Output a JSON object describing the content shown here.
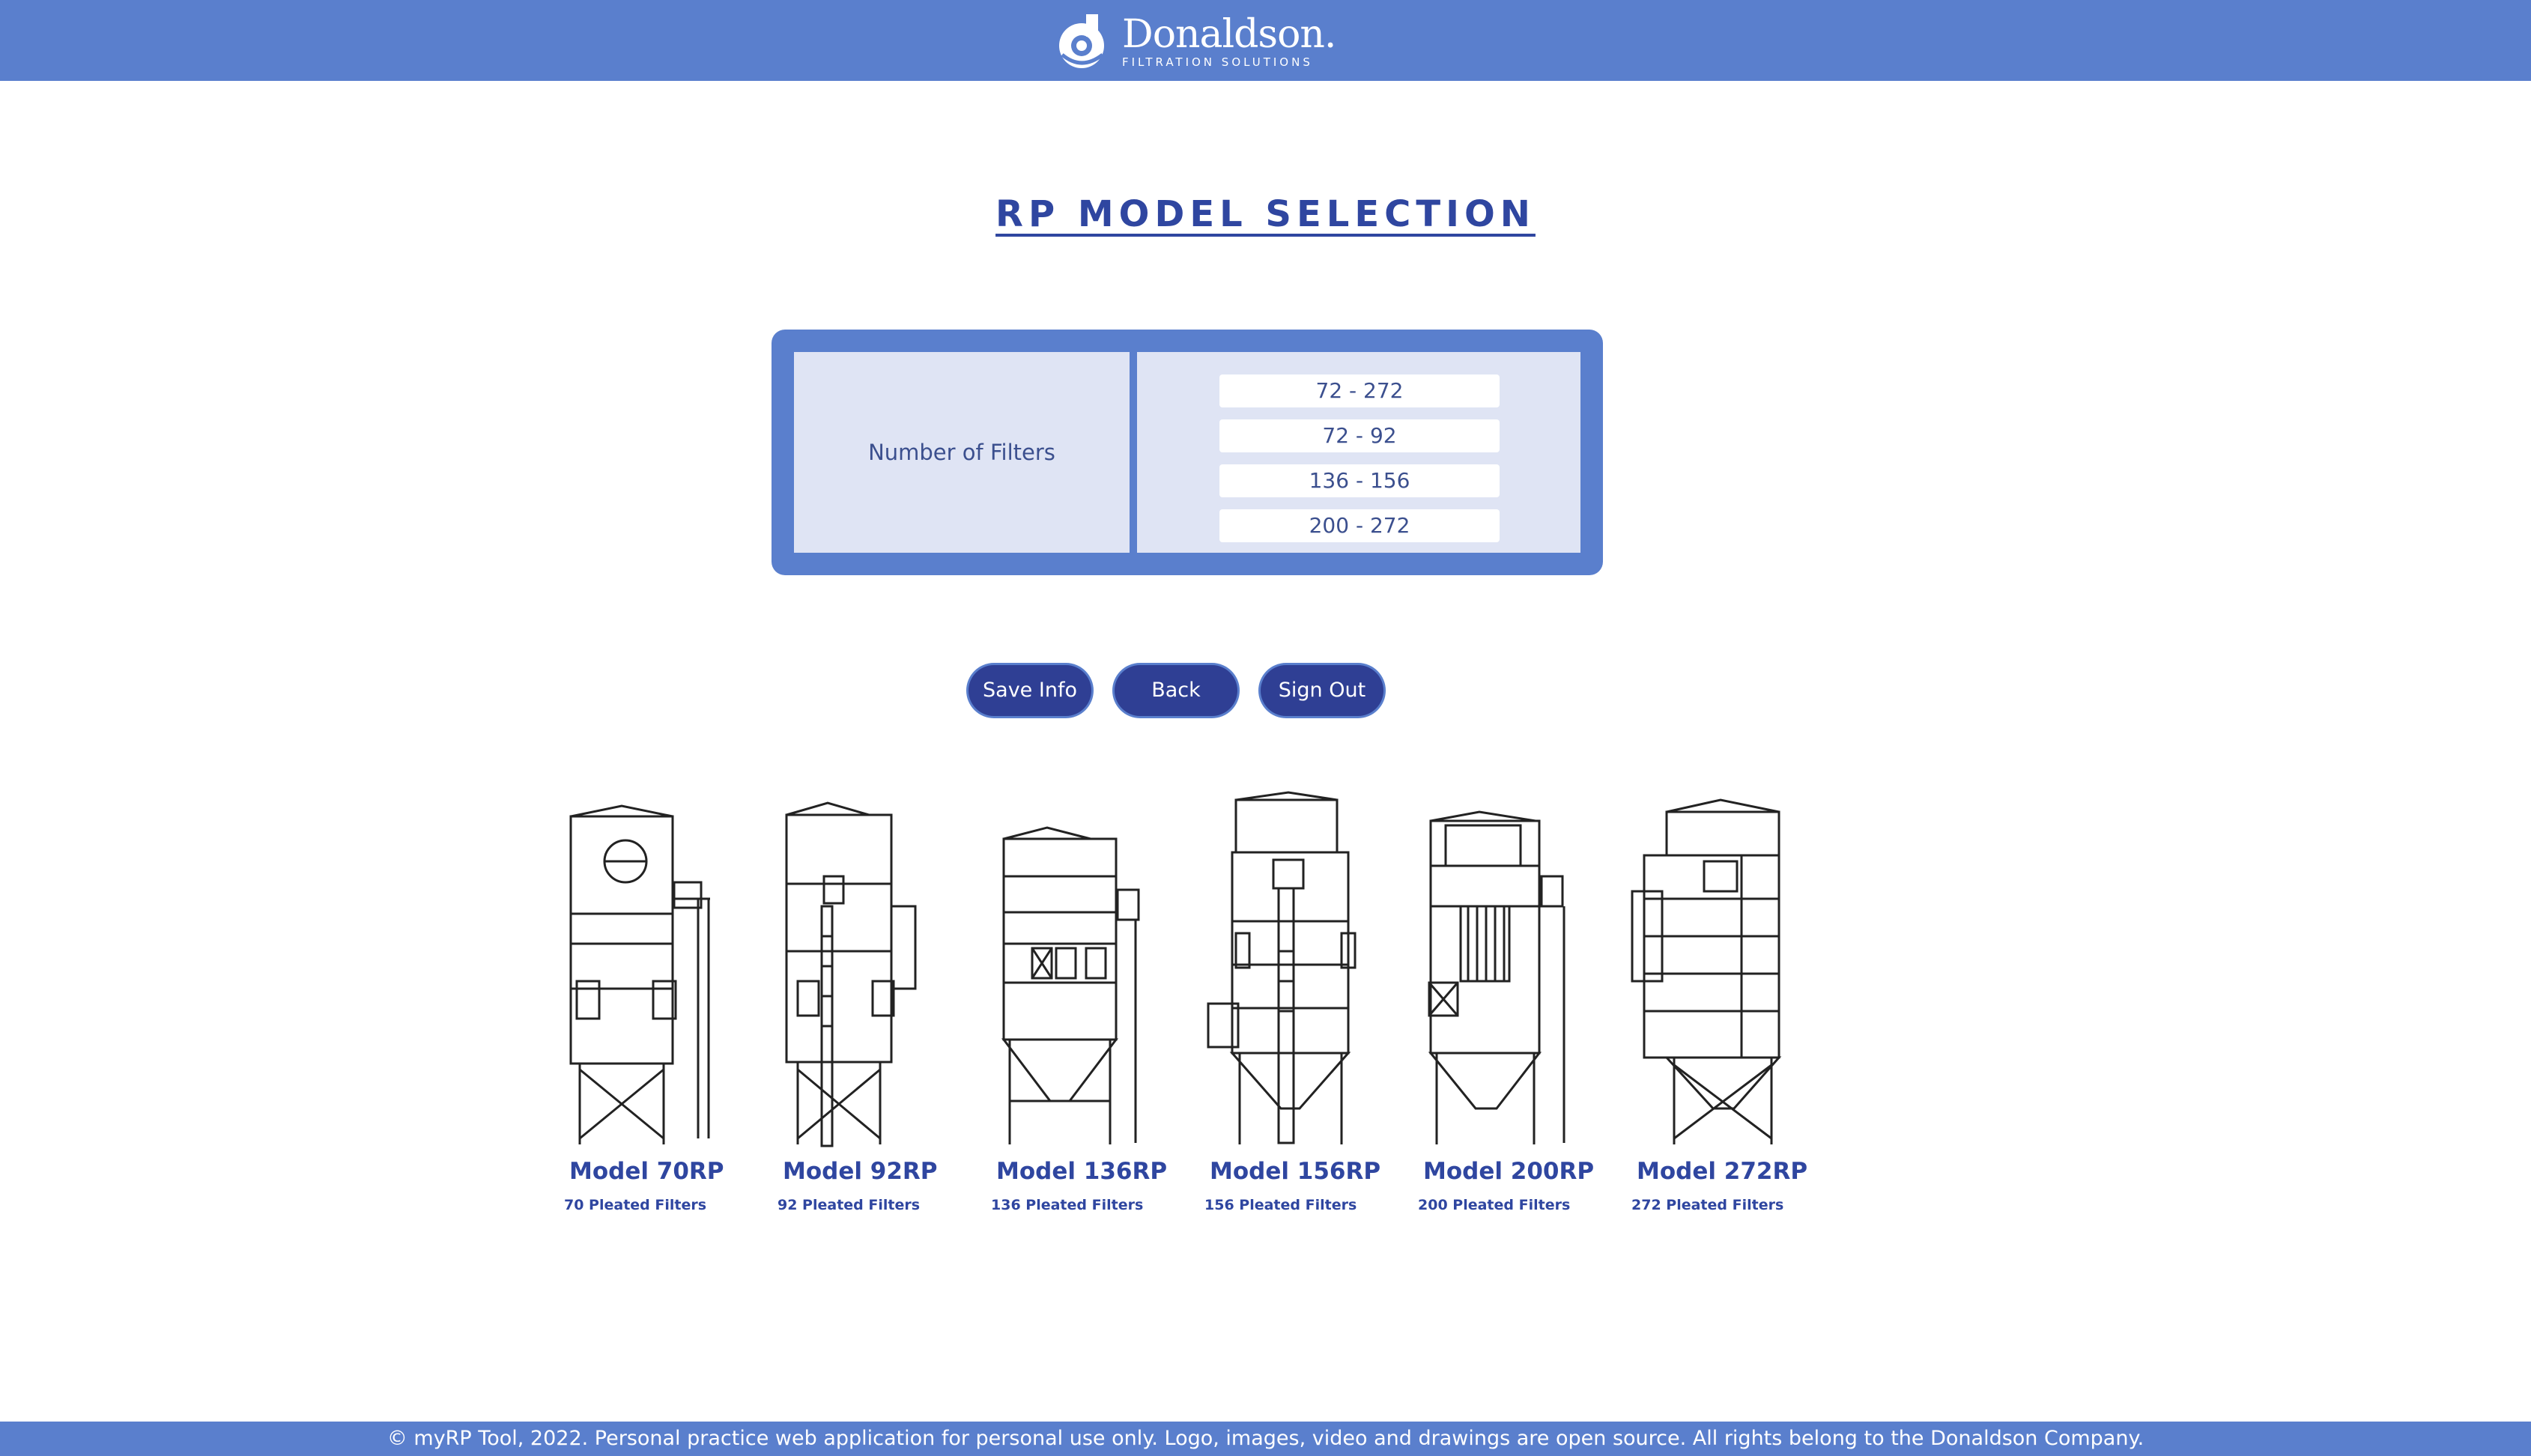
{
  "header": {
    "brand_name": "Donaldson.",
    "brand_tagline": "FILTRATION SOLUTIONS",
    "logo_icon": "donaldson-logo-icon"
  },
  "page": {
    "title": "RP MODEL SELECTION"
  },
  "selection_panel": {
    "label": "Number of Filters",
    "ranges": [
      "72 - 272",
      "72 - 92",
      "136 - 156",
      "200 - 272"
    ]
  },
  "buttons": {
    "save": "Save Info",
    "back": "Back",
    "sign_out": "Sign Out"
  },
  "models": [
    {
      "name": "Model 70RP",
      "filters": "70 Pleated Filters"
    },
    {
      "name": "Model 92RP",
      "filters": "92 Pleated Filters"
    },
    {
      "name": "Model 136RP",
      "filters": "136 Pleated Filters"
    },
    {
      "name": "Model 156RP",
      "filters": "156 Pleated Filters"
    },
    {
      "name": "Model 200RP",
      "filters": "200 Pleated Filters"
    },
    {
      "name": "Model 272RP",
      "filters": "272 Pleated Filters"
    }
  ],
  "footer": {
    "text": "© myRP Tool, 2022. Personal practice web application for personal use only. Logo, images, video and drawings are open source. All rights belong to the Donaldson Company."
  },
  "colors": {
    "brand_bar": "#5a7fcd",
    "button": "#2f3f94",
    "title": "#2f46a0",
    "panel_fill": "#dfe4f4"
  }
}
